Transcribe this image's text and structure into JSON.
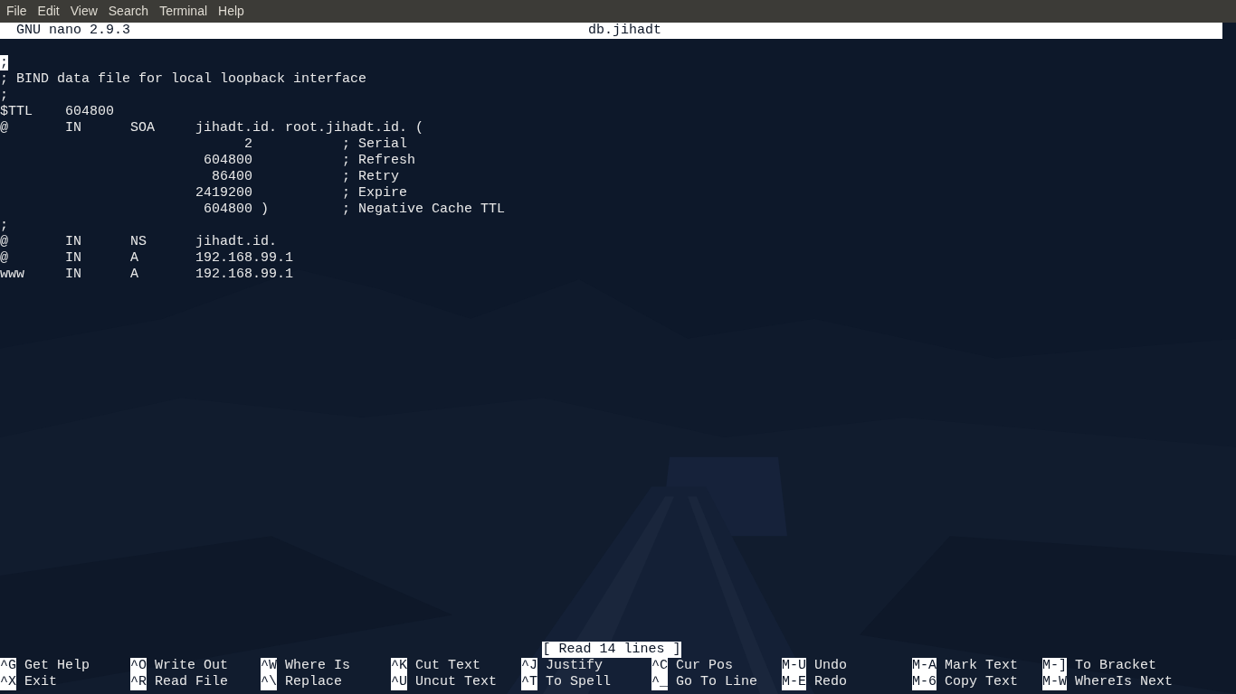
{
  "menu": [
    "File",
    "Edit",
    "View",
    "Search",
    "Terminal",
    "Help"
  ],
  "title_bar": {
    "app": "GNU nano 2.9.3",
    "file": "db.jihadt"
  },
  "lines": [
    {
      "text": ";",
      "cursor": true
    },
    {
      "text": "; BIND data file for local loopback interface",
      "cursor": false
    },
    {
      "text": ";",
      "cursor": false
    },
    {
      "text": "$TTL    604800",
      "cursor": false
    },
    {
      "text": "@       IN      SOA     jihadt.id. root.jihadt.id. (",
      "cursor": false
    },
    {
      "text": "                              2           ; Serial",
      "cursor": false
    },
    {
      "text": "                         604800           ; Refresh",
      "cursor": false
    },
    {
      "text": "                          86400           ; Retry",
      "cursor": false
    },
    {
      "text": "                        2419200           ; Expire",
      "cursor": false
    },
    {
      "text": "                         604800 )         ; Negative Cache TTL",
      "cursor": false
    },
    {
      "text": ";",
      "cursor": false
    },
    {
      "text": "@       IN      NS      jihadt.id.",
      "cursor": false
    },
    {
      "text": "@       IN      A       192.168.99.1",
      "cursor": false
    },
    {
      "text": "www     IN      A       192.168.99.1",
      "cursor": false
    }
  ],
  "status": "[ Read 14 lines ]",
  "shortcuts": [
    [
      {
        "key": "^G",
        "label": "Get Help"
      },
      {
        "key": "^O",
        "label": "Write Out"
      },
      {
        "key": "^W",
        "label": "Where Is"
      },
      {
        "key": "^K",
        "label": "Cut Text"
      },
      {
        "key": "^J",
        "label": "Justify"
      },
      {
        "key": "^C",
        "label": "Cur Pos"
      },
      {
        "key": "M-U",
        "label": "Undo"
      },
      {
        "key": "M-A",
        "label": "Mark Text"
      },
      {
        "key": "M-]",
        "label": "To Bracket"
      }
    ],
    [
      {
        "key": "^X",
        "label": "Exit"
      },
      {
        "key": "^R",
        "label": "Read File"
      },
      {
        "key": "^\\",
        "label": "Replace"
      },
      {
        "key": "^U",
        "label": "Uncut Text"
      },
      {
        "key": "^T",
        "label": "To Spell"
      },
      {
        "key": "^_",
        "label": "Go To Line"
      },
      {
        "key": "M-E",
        "label": "Redo"
      },
      {
        "key": "M-6",
        "label": "Copy Text"
      },
      {
        "key": "M-W",
        "label": "WhereIs Next"
      }
    ]
  ]
}
